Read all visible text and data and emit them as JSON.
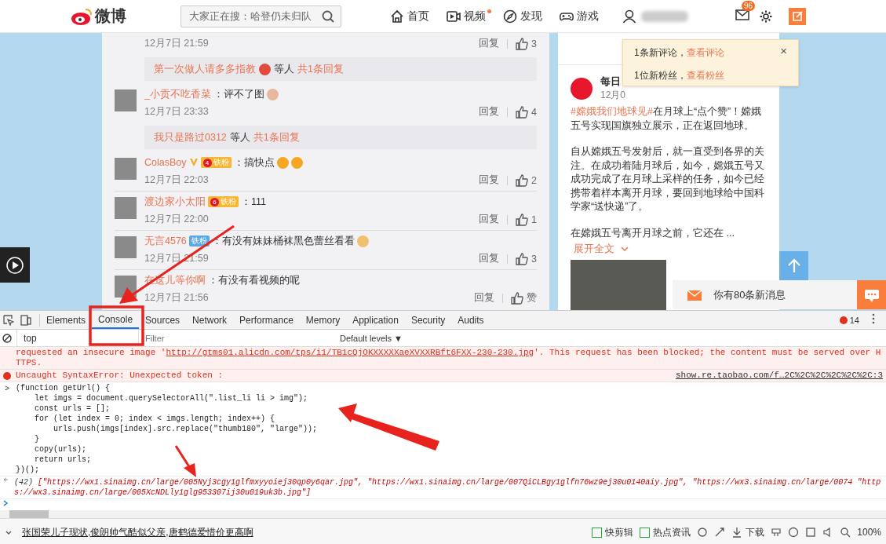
{
  "nav": {
    "logo": "微博",
    "search_placeholder": "大家正在搜：哈登仍未归队",
    "items": [
      {
        "label": "首页",
        "dot": false
      },
      {
        "label": "视频",
        "dot": true
      },
      {
        "label": "发现",
        "dot": false
      },
      {
        "label": "游戏",
        "dot": false
      }
    ],
    "mail_count": "96"
  },
  "comments": [
    {
      "kind": "comment",
      "time": "12月7日 21:59",
      "reply": "回复",
      "likes": "3"
    },
    {
      "kind": "reply_summary",
      "name": "第一次做人请多多指教",
      "middle": "等人",
      "count": "共1条回复",
      "emojis": [
        {
          "kind": "crown"
        }
      ]
    },
    {
      "kind": "comment",
      "user": "_小贡不吃香菜",
      "verified": false,
      "text": "：评不了图",
      "emojis": [
        {
          "kind": "cat"
        }
      ],
      "time": "12月7日 23:33",
      "reply": "回复",
      "likes": "4"
    },
    {
      "kind": "reply_summary",
      "name": "我只是路过0312",
      "middle": "等人",
      "count": "共1条回复"
    },
    {
      "kind": "comment",
      "user": "ColasBoy",
      "verified": true,
      "badge": {
        "kind": "level",
        "level": "4",
        "label": "铁粉"
      },
      "text": "：搞快点",
      "emojis": [
        {
          "kind": "grin"
        },
        {
          "kind": "grin"
        }
      ],
      "time": "12月7日 22:03",
      "reply": "回复",
      "likes": "2"
    },
    {
      "kind": "comment",
      "user": "渡边家小太阳",
      "verified": false,
      "badge": {
        "kind": "level",
        "level": "6",
        "label": "铁粉"
      },
      "text": "：111",
      "time": "12月7日 22:00",
      "reply": "回复",
      "likes": "1"
    },
    {
      "kind": "comment",
      "user": "无言4576",
      "verified": false,
      "badge": {
        "kind": "plain",
        "label": "铁粉"
      },
      "text": "：有没有妹妹桶袜黑色蕾丝看看",
      "emojis": [
        {
          "kind": "dog"
        }
      ],
      "time": "12月7日 21:59",
      "reply": "回复",
      "likes": "3"
    },
    {
      "kind": "comment",
      "user": "在这儿等你啊",
      "verified": false,
      "text": "：有没有看视频的呢",
      "time": "12月7日 21:56",
      "reply": "回复",
      "likes": "赞"
    }
  ],
  "notification": {
    "lines": [
      {
        "text": "1条新评论，",
        "link": "查看评论"
      },
      {
        "text": "1位新粉丝，",
        "link": "查看粉丝"
      }
    ],
    "close": "×"
  },
  "post": {
    "author": "每日",
    "time": "12月0",
    "hashtag": "#嫦娥我们地球见#",
    "paragraphs": [
      "在月球上“点个赞”！嫦娥五号实现国旗独立展示，正在返回地球。",
      "自从嫦娥五号发射后，就一直受到各界的关注。在成功着陆月球后，如今，嫦娥五号又成功完成了在月球上采样的任务，如今已经携带着样本离开月球，要回到地球给中国科学家“送快递”了。",
      "在嫦娥五号离开月球之前，它还在 ..."
    ],
    "expand": "展开全文"
  },
  "message_bar": {
    "text": "你有80条新消息"
  },
  "devtools": {
    "tabs": [
      {
        "label": "Elements",
        "selected": false
      },
      {
        "label": "Console",
        "selected": true
      },
      {
        "label": "Sources",
        "selected": false
      },
      {
        "label": "Network",
        "selected": false
      },
      {
        "label": "Performance",
        "selected": false
      },
      {
        "label": "Memory",
        "selected": false
      },
      {
        "label": "Application",
        "selected": false
      },
      {
        "label": "Security",
        "selected": false
      },
      {
        "label": "Audits",
        "selected": false
      }
    ],
    "error_count": "14",
    "context": "top",
    "filter_placeholder": "Filter",
    "levels": "Default levels ▼",
    "messages": [
      {
        "kind": "error_cont",
        "before": "requested an insecure image '",
        "link": "http://gtms01.alicdn.com/tps/i1/TB1cQjOKXXXXXaeXVXXRBft6FXX-230-230.jpg",
        "after": "'. This request has been blocked; the content must be served over HTTPS."
      },
      {
        "kind": "error",
        "text": "Uncaught SyntaxError: Unexpected token :",
        "source": "show.re.taobao.com/f…2C%2C%2C%2C%2C%2C:3"
      },
      {
        "kind": "input",
        "prompt": ">",
        "lines": [
          "(function getUrl() {",
          "    let imgs = document.querySelectorAll(\".list_li li > img\");",
          "    const urls = [];",
          "    for (let index = 0; index < imgs.length; index++) {",
          "        urls.push(imgs[index].src.replace(\"thumb180\", \"large\"));",
          "    }",
          "    copy(urls);",
          "    return urls;",
          "})();"
        ]
      },
      {
        "kind": "result",
        "count": "(42)",
        "text": "[\"https://wx1.sinaimg.cn/large/005Nyj3cgy1glfmxyyoiej30qp0y6qar.jpg\", \"https://wx1.sinaimg.cn/large/007QiCLBgy1glfn76wz9ej30u0140aiy.jpg\", \"https://wx3.sinaimg.cn/large/0074 \"https://wx3.sinaimg.cn/large/005XcNDLly1glg953307ij30u019uk3b.jpg\"]"
      },
      {
        "kind": "prompt"
      }
    ]
  },
  "status_bar": {
    "news": "张国荣儿子现状,俊朗帅气酷似父亲,唐鹤德爱惜价更高啊",
    "items": [
      {
        "label": "快剪辑"
      },
      {
        "label": "热点资讯"
      }
    ],
    "download": "下载",
    "zoom": "100%"
  }
}
